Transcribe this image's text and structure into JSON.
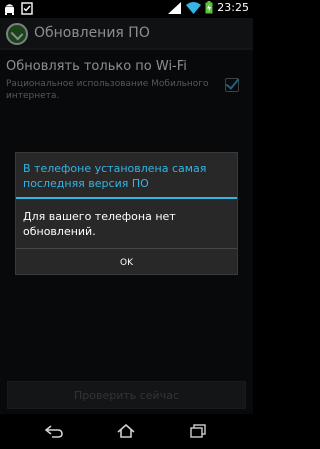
{
  "status_bar": {
    "time": "23:25",
    "icons": [
      "android-notification-icon",
      "checklist-notification-icon",
      "signal-icon",
      "wifi-icon",
      "battery-charging-icon"
    ]
  },
  "action_bar": {
    "title": "Обновления ПО",
    "icon": "system-update-icon"
  },
  "preference": {
    "title": "Обновлять только по Wi-Fi",
    "summary": "Рациональное использование Мобильного интернета.",
    "checked": true
  },
  "check_now_button": {
    "label": "Проверить сейчас",
    "enabled": false
  },
  "dialog": {
    "title": "В телефоне установлена самая последняя версия ПО",
    "message": "Для вашего телефона нет обновлений.",
    "ok_label": "OK"
  },
  "nav_bar": {
    "buttons": [
      "back-icon",
      "home-icon",
      "recent-apps-icon"
    ]
  },
  "colors": {
    "accent": "#33b5e5",
    "background": "#101214",
    "dialog_background": "#282828"
  }
}
